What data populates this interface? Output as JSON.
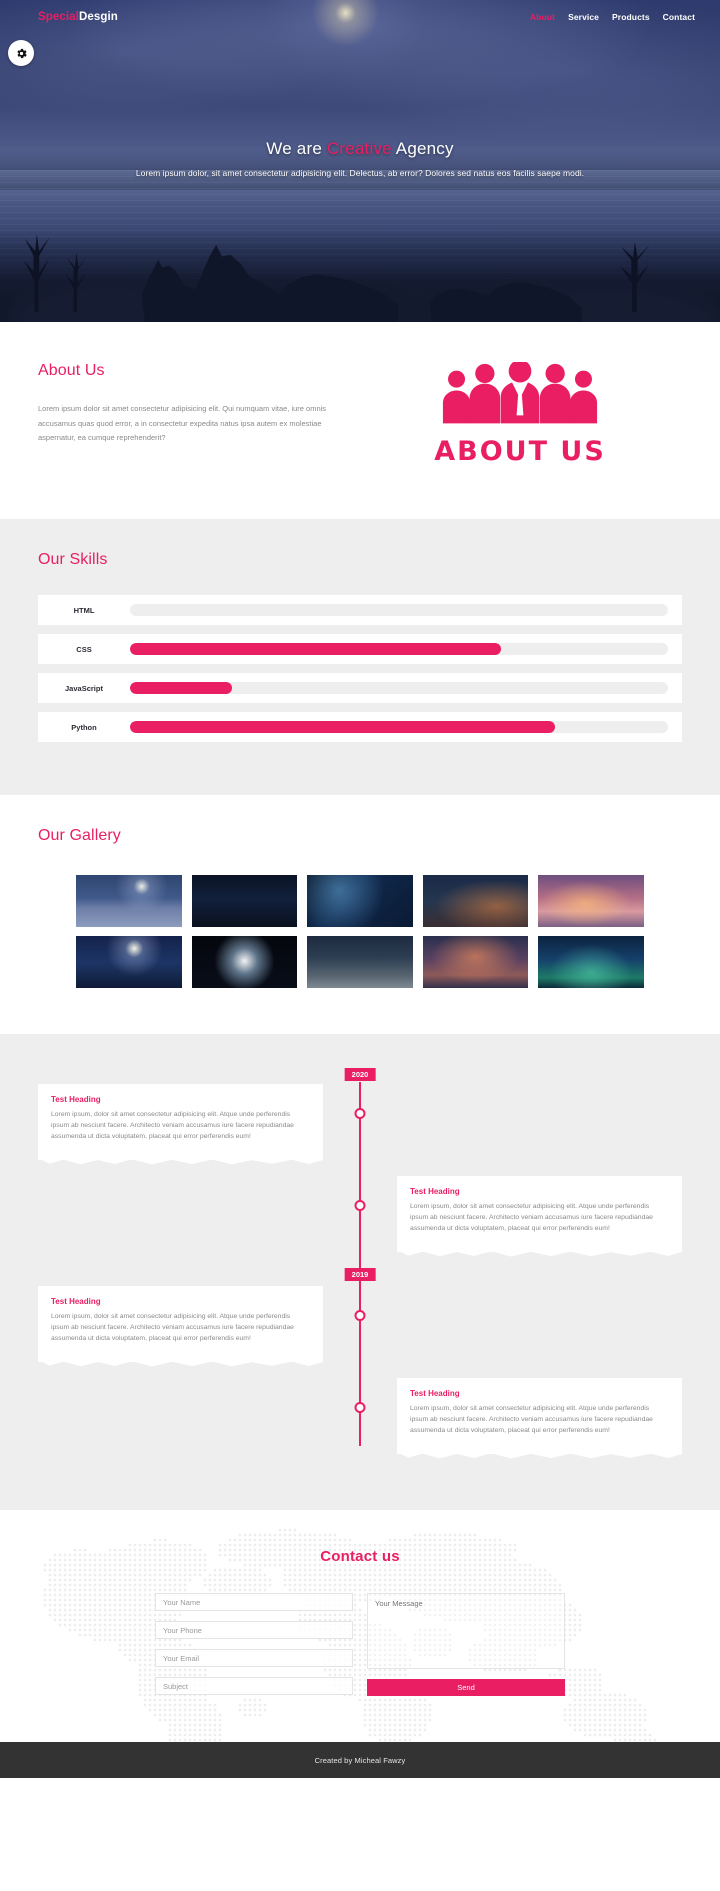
{
  "colors": {
    "accent": "#e91e63",
    "dark_bg": "#2b3566",
    "section_gray": "#eeeeee",
    "footer_bg": "#333333",
    "muted_text": "#8a8a8a"
  },
  "nav": {
    "logo_first": "Special",
    "logo_second": "Desgin",
    "links": [
      {
        "label": "About",
        "active": true
      },
      {
        "label": "Service",
        "active": false
      },
      {
        "label": "Products",
        "active": false
      },
      {
        "label": "Contact",
        "active": false
      }
    ],
    "settings_icon": "gear-icon"
  },
  "hero": {
    "title_pre": "We are ",
    "title_accent": "Creative",
    "title_post": " Agency",
    "subtitle": "Lorem ipsum dolor, sit amet consectetur adipisicing elit. Delectus, ab error? Dolores sed natus eos facilis saepe modi."
  },
  "about": {
    "title": "About Us",
    "paragraph": "Lorem ipsum dolor sit amet consectetur adipisicing elit. Qui numquam vitae, iure omnis accusamus quas quod error, a in consectetur expedita natus ipsa autem ex molestiae aspernatur, ea cumque reprehenderit?",
    "image_caption": "ABOUT US",
    "image_icon": "people-group-icon"
  },
  "skills": {
    "title": "Our Skills",
    "items": [
      {
        "label": "HTML",
        "percent": 0
      },
      {
        "label": "CSS",
        "percent": 69
      },
      {
        "label": "JavaScript",
        "percent": 19
      },
      {
        "label": "Python",
        "percent": 79
      }
    ]
  },
  "gallery": {
    "title": "Our Gallery",
    "items": [
      {
        "name": "gallery-image-1"
      },
      {
        "name": "gallery-image-2"
      },
      {
        "name": "gallery-image-3"
      },
      {
        "name": "gallery-image-4"
      },
      {
        "name": "gallery-image-5"
      },
      {
        "name": "gallery-image-6"
      },
      {
        "name": "gallery-image-7"
      },
      {
        "name": "gallery-image-8"
      },
      {
        "name": "gallery-image-9"
      },
      {
        "name": "gallery-image-10"
      }
    ]
  },
  "timeline": {
    "years": [
      "2020",
      "2019"
    ],
    "entries": [
      {
        "side": "left",
        "heading": "Test Heading",
        "body": "Lorem ipsum, dolor sit amet consectetur adipisicing elit. Atque unde perferendis ipsum ab nesciunt facere. Architecto veniam accusamus iure facere repudiandae assumenda ut dicta voluptatem, placeat qui error perferendis eum!"
      },
      {
        "side": "right",
        "heading": "Test Heading",
        "body": "Lorem ipsum, dolor sit amet consectetur adipisicing elit. Atque unde perferendis ipsum ab nesciunt facere. Architecto veniam accusamus iure facere repudiandae assumenda ut dicta voluptatem, placeat qui error perferendis eum!"
      },
      {
        "side": "left",
        "heading": "Test Heading",
        "body": "Lorem ipsum, dolor sit amet consectetur adipisicing elit. Atque unde perferendis ipsum ab nesciunt facere. Architecto veniam accusamus iure facere repudiandae assumenda ut dicta voluptatem, placeat qui error perferendis eum!"
      },
      {
        "side": "right",
        "heading": "Test Heading",
        "body": "Lorem ipsum, dolor sit amet consectetur adipisicing elit. Atque unde perferendis ipsum ab nesciunt facere. Architecto veniam accusamus iure facere repudiandae assumenda ut dicta voluptatem, placeat qui error perferendis eum!"
      }
    ]
  },
  "contact": {
    "title": "Contact us",
    "fields": {
      "name_placeholder": "Your Name",
      "phone_placeholder": "Your Phone",
      "email_placeholder": "Your Email",
      "subject_placeholder": "Subject",
      "message_placeholder": "Your Message"
    },
    "send_label": "Send"
  },
  "footer": {
    "text": "Created by Micheal Fawzy"
  }
}
